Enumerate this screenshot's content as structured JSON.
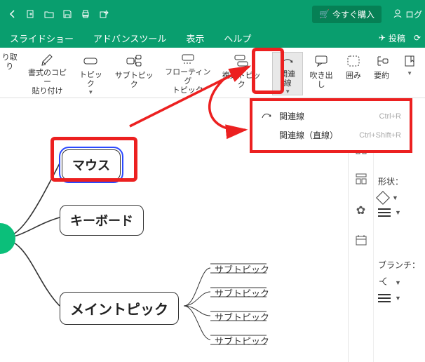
{
  "titlebar": {
    "buy_label": "今すぐ購入",
    "login_label": "ログ"
  },
  "menu": {
    "items": [
      "スライドショー",
      "アドバンスツール",
      "表示",
      "ヘルプ"
    ],
    "post_label": "投稿"
  },
  "ribbon": {
    "items": [
      {
        "label1": "り取り"
      },
      {
        "label1": "書式のコピー",
        "label2": "貼り付け"
      },
      {
        "label1": "トピック"
      },
      {
        "label1": "サブトピック"
      },
      {
        "label1": "フローティング",
        "label2": "トピック"
      },
      {
        "label1": "複数トピック"
      },
      {
        "label1": "関連線",
        "active": true
      },
      {
        "label1": "吹き出し"
      },
      {
        "label1": "囲み"
      },
      {
        "label1": "要約"
      }
    ]
  },
  "dropdown": {
    "rows": [
      {
        "label": "関連線",
        "shortcut": "Ctrl+R"
      },
      {
        "label": "関連線（直線）",
        "shortcut": "Ctrl+Shift+R"
      }
    ]
  },
  "canvas": {
    "nodes": {
      "mouse": "マウス",
      "keyboard": "キーボード",
      "main": "メイントピック"
    },
    "subs": [
      "サブトピック",
      "サブトピック",
      "サブトピック",
      "サブトピック"
    ]
  },
  "sidepanel": {
    "shape_label": "形状：",
    "branch_label": "ブランチ："
  }
}
